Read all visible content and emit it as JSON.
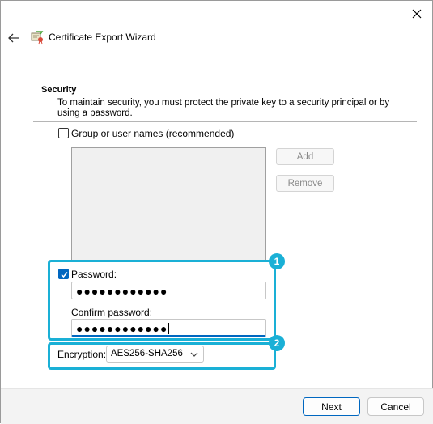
{
  "window": {
    "title": "Certificate Export Wizard"
  },
  "security": {
    "heading": "Security",
    "description": "To maintain security, you must protect the private key to a security principal or by using a password."
  },
  "group_option": {
    "label": "Group or user names (recommended)",
    "checked": false
  },
  "side_buttons": {
    "add": "Add",
    "remove": "Remove"
  },
  "password_option": {
    "label": "Password:",
    "checked": true
  },
  "password": {
    "value": "●●●●●●●●●●●●"
  },
  "confirm": {
    "label": "Confirm password:",
    "value": "●●●●●●●●●●●●"
  },
  "encryption": {
    "label": "Encryption:",
    "selected": "AES256-SHA256"
  },
  "annotations": {
    "badge1": "1",
    "badge2": "2",
    "color": "#1ab0d6"
  },
  "footer": {
    "next": "Next",
    "cancel": "Cancel"
  },
  "colors": {
    "accent": "#0067c0"
  }
}
